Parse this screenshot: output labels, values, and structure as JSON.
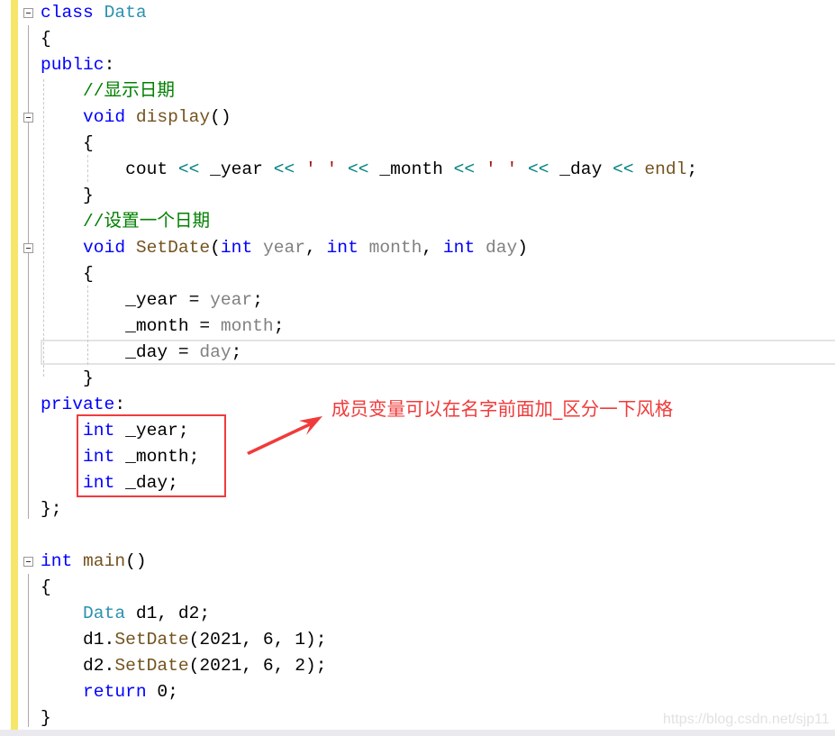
{
  "code_lines": [
    {
      "row": 0,
      "tokens": [
        [
          "class ",
          "k"
        ],
        [
          "Data",
          "t"
        ]
      ]
    },
    {
      "row": 1,
      "tokens": [
        [
          "{",
          "n"
        ]
      ]
    },
    {
      "row": 2,
      "tokens": [
        [
          "public",
          "k"
        ],
        [
          ":",
          "n"
        ]
      ]
    },
    {
      "row": 3,
      "tokens": [
        [
          "    //显示日期",
          "c"
        ]
      ]
    },
    {
      "row": 4,
      "tokens": [
        [
          "    ",
          "n"
        ],
        [
          "void ",
          "k"
        ],
        [
          "display",
          "f"
        ],
        [
          "()",
          "n"
        ]
      ]
    },
    {
      "row": 5,
      "tokens": [
        [
          "    {",
          "n"
        ]
      ]
    },
    {
      "row": 6,
      "tokens": [
        [
          "        cout ",
          "n"
        ],
        [
          "<<",
          "o"
        ],
        [
          " _year ",
          "n"
        ],
        [
          "<<",
          "o"
        ],
        [
          " ",
          "n"
        ],
        [
          "' '",
          "s"
        ],
        [
          " ",
          "n"
        ],
        [
          "<<",
          "o"
        ],
        [
          " _month ",
          "n"
        ],
        [
          "<<",
          "o"
        ],
        [
          " ",
          "n"
        ],
        [
          "' '",
          "s"
        ],
        [
          " ",
          "n"
        ],
        [
          "<<",
          "o"
        ],
        [
          " _day ",
          "n"
        ],
        [
          "<<",
          "o"
        ],
        [
          " ",
          "n"
        ],
        [
          "endl",
          "f"
        ],
        [
          ";",
          "n"
        ]
      ]
    },
    {
      "row": 7,
      "tokens": [
        [
          "    }",
          "n"
        ]
      ]
    },
    {
      "row": 8,
      "tokens": [
        [
          "    //设置一个日期",
          "c"
        ]
      ]
    },
    {
      "row": 9,
      "tokens": [
        [
          "    ",
          "n"
        ],
        [
          "void ",
          "k"
        ],
        [
          "SetDate",
          "f"
        ],
        [
          "(",
          "n"
        ],
        [
          "int ",
          "k"
        ],
        [
          "year",
          "p"
        ],
        [
          ", ",
          "n"
        ],
        [
          "int ",
          "k"
        ],
        [
          "month",
          "p"
        ],
        [
          ", ",
          "n"
        ],
        [
          "int ",
          "k"
        ],
        [
          "day",
          "p"
        ],
        [
          ")",
          "n"
        ]
      ]
    },
    {
      "row": 10,
      "tokens": [
        [
          "    {",
          "n"
        ]
      ]
    },
    {
      "row": 11,
      "tokens": [
        [
          "        _year = ",
          "n"
        ],
        [
          "year",
          "p"
        ],
        [
          ";",
          "n"
        ]
      ]
    },
    {
      "row": 12,
      "tokens": [
        [
          "        _month = ",
          "n"
        ],
        [
          "month",
          "p"
        ],
        [
          ";",
          "n"
        ]
      ]
    },
    {
      "row": 13,
      "tokens": [
        [
          "        _day = ",
          "n"
        ],
        [
          "day",
          "p"
        ],
        [
          ";",
          "n"
        ]
      ]
    },
    {
      "row": 14,
      "tokens": [
        [
          "    }",
          "n"
        ]
      ]
    },
    {
      "row": 15,
      "tokens": [
        [
          "private",
          "k"
        ],
        [
          ":",
          "n"
        ]
      ]
    },
    {
      "row": 16,
      "tokens": [
        [
          "    ",
          "n"
        ],
        [
          "int ",
          "k"
        ],
        [
          "_year;",
          "n"
        ]
      ]
    },
    {
      "row": 17,
      "tokens": [
        [
          "    ",
          "n"
        ],
        [
          "int ",
          "k"
        ],
        [
          "_month;",
          "n"
        ]
      ]
    },
    {
      "row": 18,
      "tokens": [
        [
          "    ",
          "n"
        ],
        [
          "int ",
          "k"
        ],
        [
          "_day;",
          "n"
        ]
      ]
    },
    {
      "row": 19,
      "tokens": [
        [
          "};",
          "n"
        ]
      ]
    },
    {
      "row": 21,
      "tokens": [
        [
          "int ",
          "k"
        ],
        [
          "main",
          "f"
        ],
        [
          "()",
          "n"
        ]
      ]
    },
    {
      "row": 22,
      "tokens": [
        [
          "{",
          "n"
        ]
      ]
    },
    {
      "row": 23,
      "tokens": [
        [
          "    ",
          "n"
        ],
        [
          "Data ",
          "t"
        ],
        [
          "d1, d2;",
          "n"
        ]
      ]
    },
    {
      "row": 24,
      "tokens": [
        [
          "    d1.",
          "n"
        ],
        [
          "SetDate",
          "f"
        ],
        [
          "(2021, 6, 1);",
          "n"
        ]
      ]
    },
    {
      "row": 25,
      "tokens": [
        [
          "    d2.",
          "n"
        ],
        [
          "SetDate",
          "f"
        ],
        [
          "(2021, 6, 2);",
          "n"
        ]
      ]
    },
    {
      "row": 26,
      "tokens": [
        [
          "    ",
          "n"
        ],
        [
          "return ",
          "k"
        ],
        [
          "0;",
          "n"
        ]
      ]
    },
    {
      "row": 27,
      "tokens": [
        [
          "}",
          "n"
        ]
      ]
    }
  ],
  "annotation": {
    "text": "成员变量可以在名字前面加_区分一下风格",
    "color": "#f03b3b"
  },
  "watermark": "https://blog.csdn.net/sjp11",
  "colors": {
    "keyword": "#0000ff",
    "type": "#2b91af",
    "function": "#74531f",
    "parameter": "#808080",
    "comment": "#008000",
    "operator": "#008080",
    "string": "#a31515",
    "change_bar": "#f5e66a"
  }
}
